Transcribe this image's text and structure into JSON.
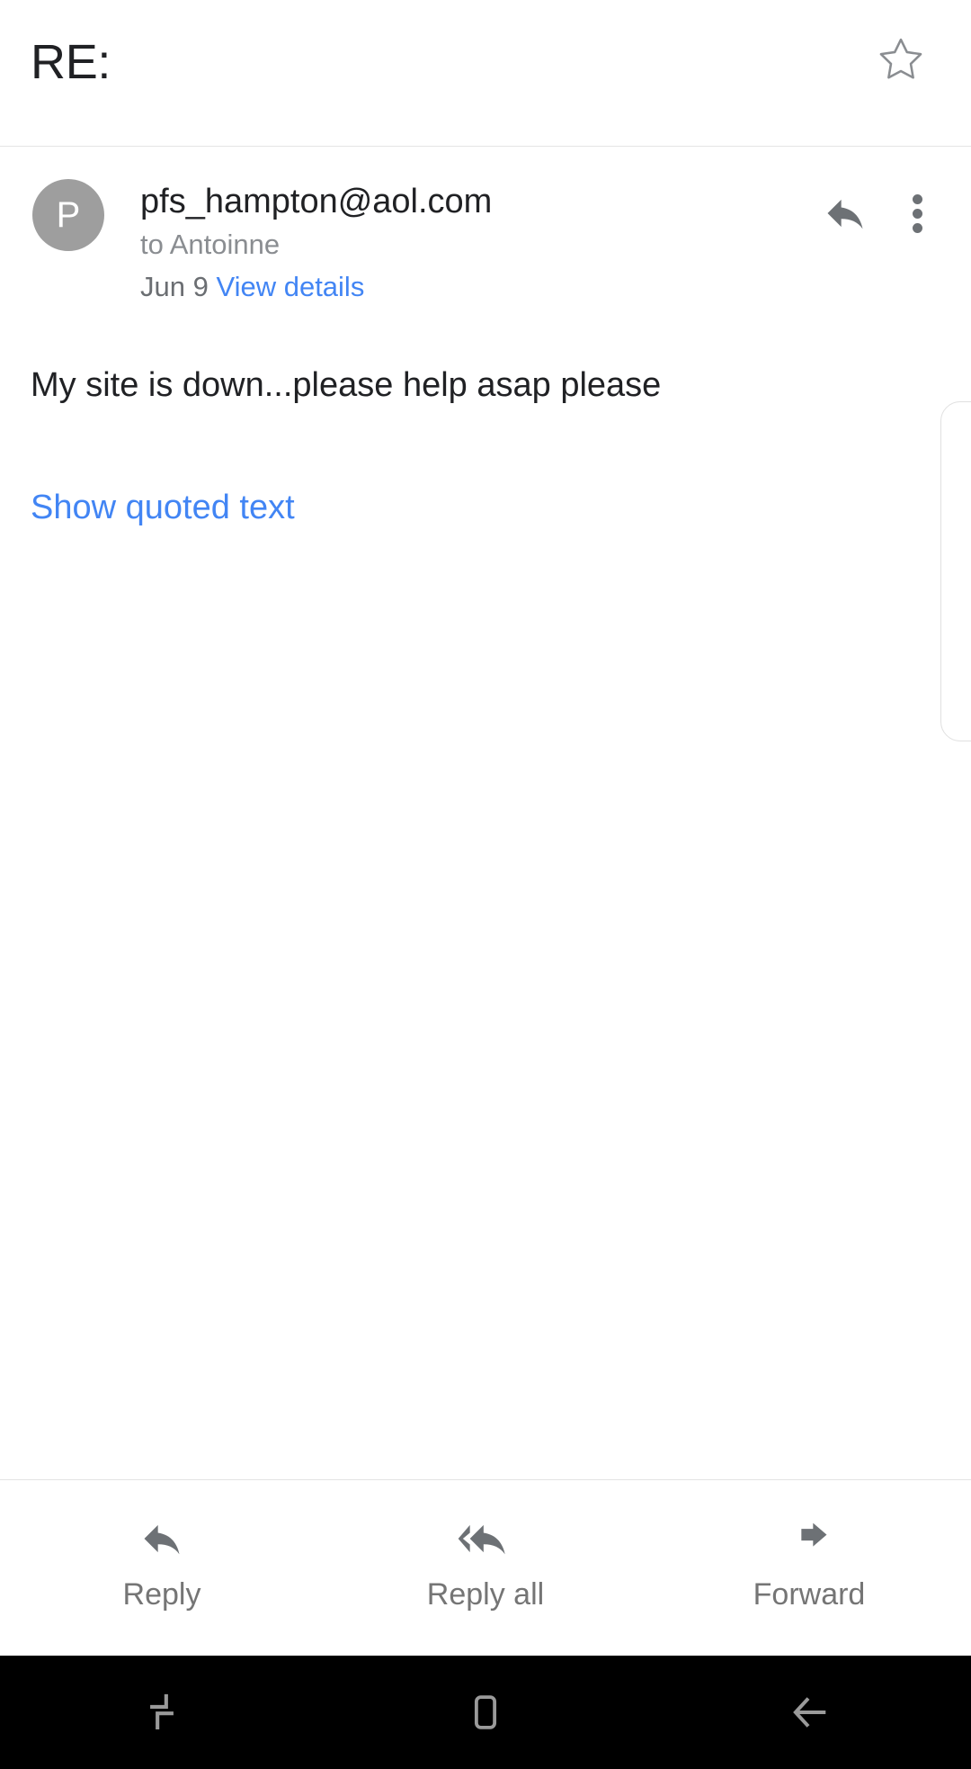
{
  "app": {
    "name": "Gmail",
    "platform": "Android"
  },
  "header": {
    "subject": "RE:",
    "star_icon": "star-outline-icon",
    "star_filled": false
  },
  "message": {
    "avatar_initial": "P",
    "avatar_color": "#9e9e9e",
    "sender_email": "pfs_hampton@aol.com",
    "recipient_line": "to Antoinne",
    "date": "Jun 9",
    "details_link": "View details",
    "reply_icon": "reply-arrow-icon",
    "overflow_icon": "more-vertical-icon",
    "body": "My site is down...please help asap please",
    "quoted_text_link": "Show quoted text"
  },
  "reply_bar": {
    "actions": [
      {
        "label": "Reply",
        "icon": "reply-arrow-icon"
      },
      {
        "label": "Reply all",
        "icon": "reply-all-arrow-icon"
      },
      {
        "label": "Forward",
        "icon": "forward-arrow-icon"
      }
    ]
  },
  "navbar": {
    "buttons": [
      {
        "name": "recents",
        "icon": "recents-icon"
      },
      {
        "name": "home",
        "icon": "home-square-icon"
      },
      {
        "name": "back",
        "icon": "back-arrow-icon"
      }
    ],
    "background": "#000000",
    "icon_color": "#9a9a9a"
  },
  "colors": {
    "link": "#4285f4",
    "text_primary": "#202124",
    "text_secondary": "#8a8d91",
    "icon_gray": "#6d7175",
    "divider": "#e4e4e4"
  }
}
